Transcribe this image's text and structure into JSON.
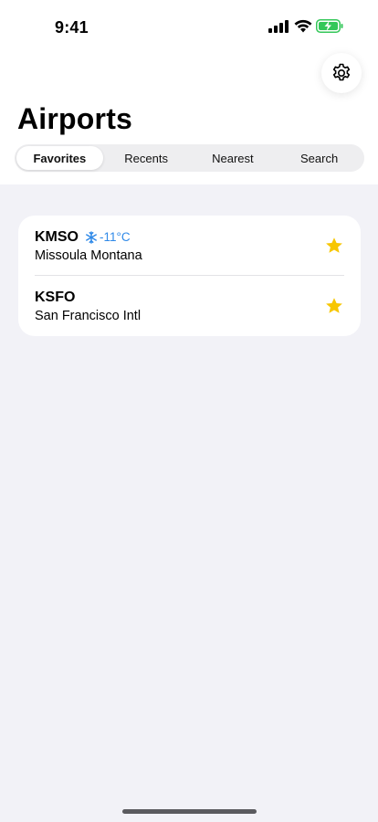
{
  "status_bar": {
    "time": "9:41",
    "battery_color": "#34c759"
  },
  "header": {
    "title": "Airports",
    "settings_icon": "gear-icon"
  },
  "tabs": [
    {
      "label": "Favorites",
      "selected": true
    },
    {
      "label": "Recents",
      "selected": false
    },
    {
      "label": "Nearest",
      "selected": false
    },
    {
      "label": "Search",
      "selected": false
    }
  ],
  "airports": [
    {
      "code": "KMSO",
      "name": "Missoula Montana",
      "weather_icon": "snowflake-icon",
      "temperature": "-11°C",
      "favorite": true
    },
    {
      "code": "KSFO",
      "name": "San Francisco Intl",
      "favorite": true
    }
  ],
  "colors": {
    "accent_star": "#f7c600",
    "weather_text": "#2f89e8",
    "background": "#f2f2f7"
  }
}
